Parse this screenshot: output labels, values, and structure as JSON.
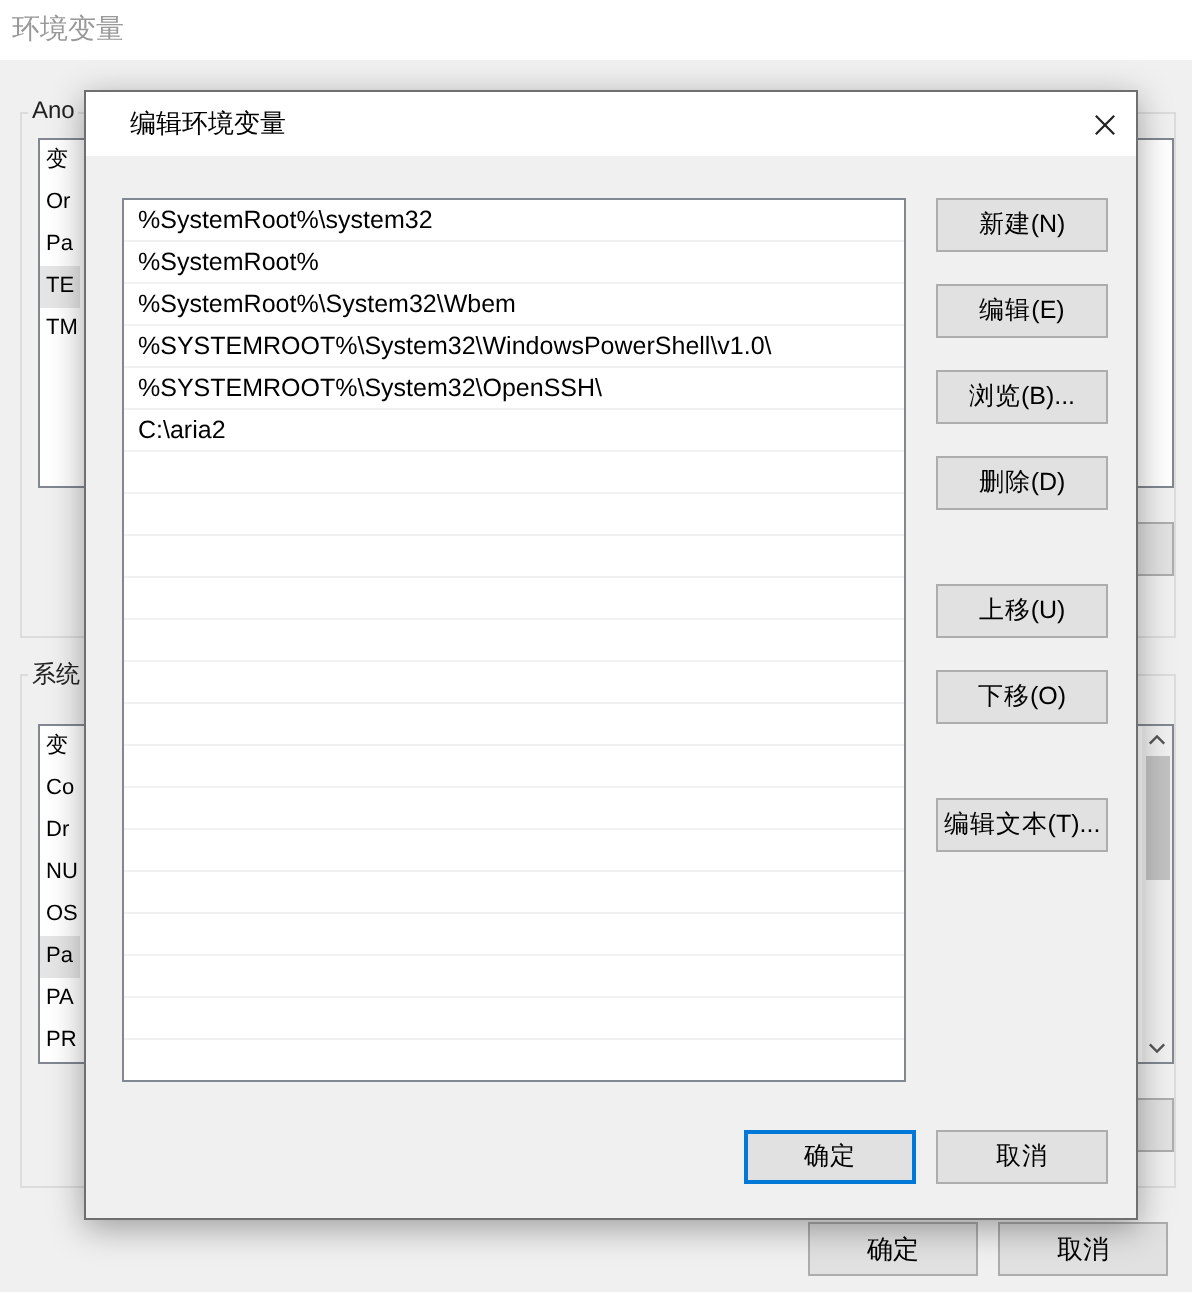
{
  "background_window": {
    "title": "环境变量",
    "user_group": {
      "label": "Ano",
      "items": [
        {
          "text": "变",
          "selected": false
        },
        {
          "text": "Or",
          "selected": false
        },
        {
          "text": "Pa",
          "selected": false
        },
        {
          "text": "TE",
          "selected": true
        },
        {
          "text": "TM",
          "selected": false
        }
      ]
    },
    "system_group": {
      "label": "系统",
      "items": [
        {
          "text": "变",
          "selected": false
        },
        {
          "text": "Co",
          "selected": false
        },
        {
          "text": "Dr",
          "selected": false
        },
        {
          "text": "NU",
          "selected": false
        },
        {
          "text": "OS",
          "selected": false
        },
        {
          "text": "Pa",
          "selected": true
        },
        {
          "text": "PA",
          "selected": false
        },
        {
          "text": "PR",
          "selected": false
        }
      ]
    },
    "buttons": [
      {
        "label": "确定"
      },
      {
        "label": "取消"
      }
    ]
  },
  "dialog": {
    "title": "编辑环境变量",
    "paths": [
      {
        "text": "%SystemRoot%\\system32"
      },
      {
        "text": "%SystemRoot%"
      },
      {
        "text": "%SystemRoot%\\System32\\Wbem"
      },
      {
        "text": "%SYSTEMROOT%\\System32\\WindowsPowerShell\\v1.0\\"
      },
      {
        "text": "%SYSTEMROOT%\\System32\\OpenSSH\\"
      },
      {
        "text": "C:\\aria2"
      }
    ],
    "side_button_groups": [
      [
        {
          "label": "新建(N)"
        },
        {
          "label": "编辑(E)"
        },
        {
          "label": "浏览(B)..."
        },
        {
          "label": "删除(D)"
        }
      ],
      [
        {
          "label": "上移(U)"
        },
        {
          "label": "下移(O)"
        }
      ],
      [
        {
          "label": "编辑文本(T)..."
        }
      ]
    ],
    "footer_buttons": [
      {
        "label": "确定",
        "kind": "default"
      },
      {
        "label": "取消",
        "kind": "normal"
      }
    ]
  }
}
